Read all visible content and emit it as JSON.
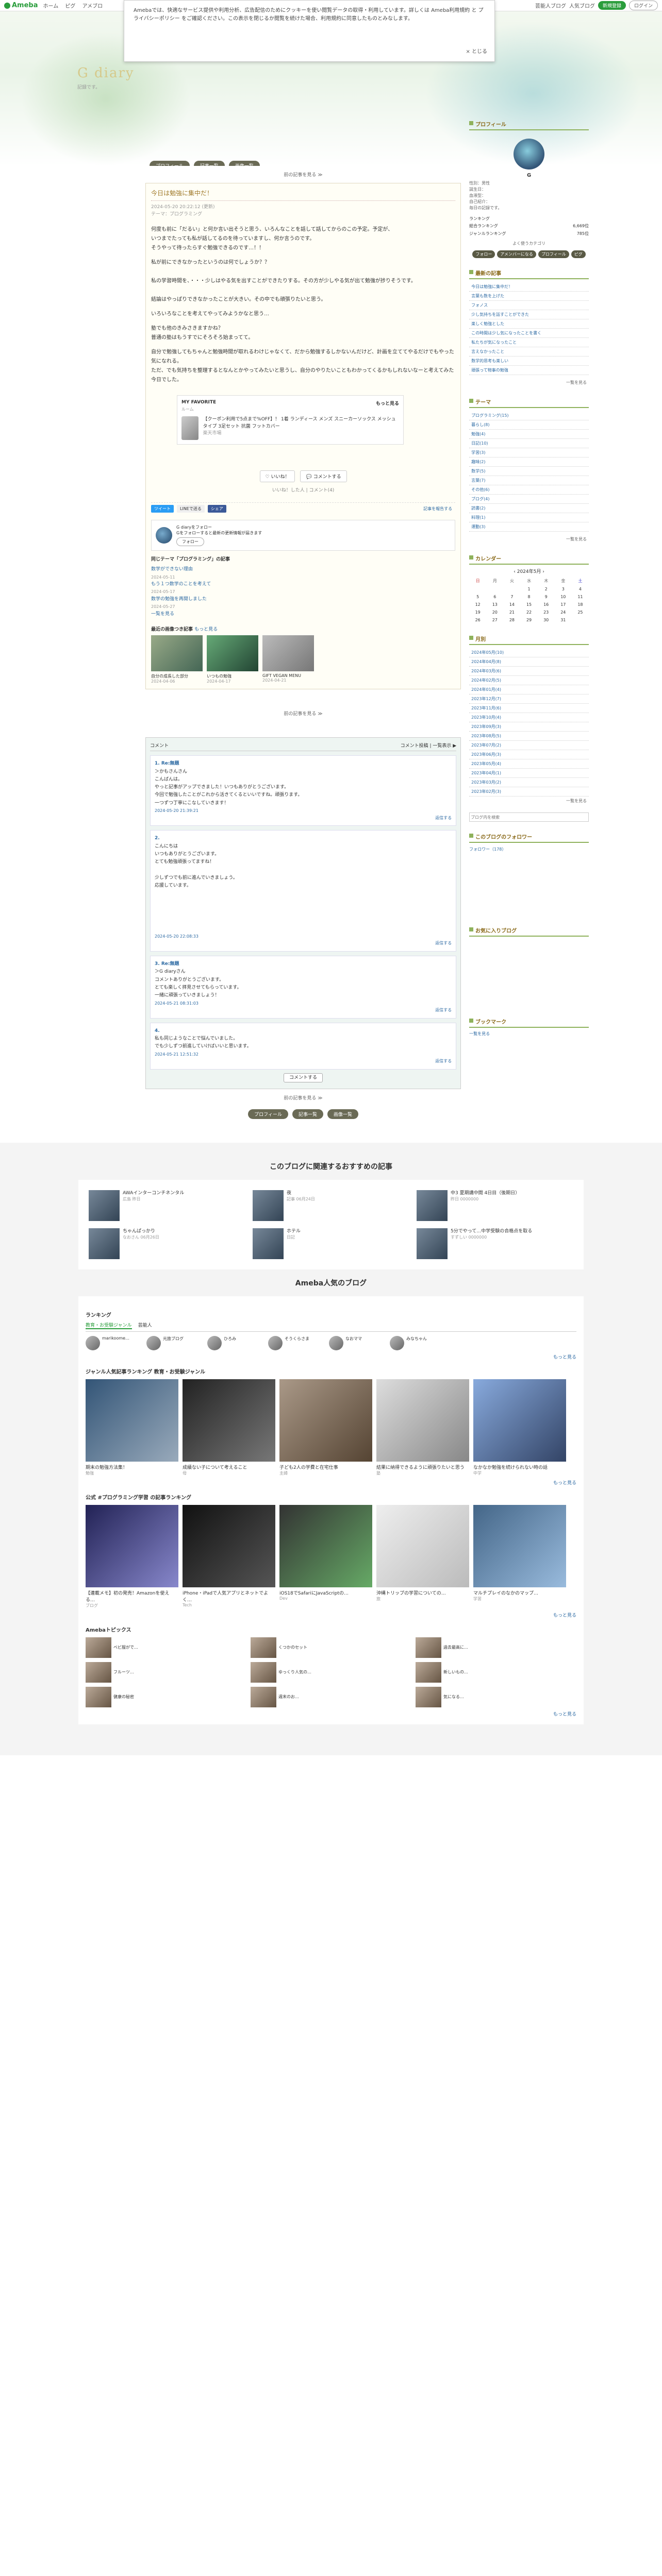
{
  "topbar": {
    "logo": "Ameba",
    "nav": [
      "ホーム",
      "ピグ",
      "アメブロ"
    ],
    "right": [
      "芸能人ブログ",
      "人気ブログ"
    ],
    "signup": "新規登録",
    "login": "ログイン"
  },
  "cookie": {
    "text": "Amebaでは、快適なサービス提供や利用分析、広告配信のためにクッキーを使い閲覧データの取得・利用しています。詳しくは Ameba利用規約 と プライバシーポリシー をご確認ください。この表示を閉じるか閲覧を続けた場合、利用規約に同意したものとみなします。",
    "close": "× とじる"
  },
  "header": {
    "title": "G   diary",
    "subtitle": "記録です。",
    "btns": [
      "プロフィール",
      "記事一覧",
      "画像一覧"
    ]
  },
  "entry": {
    "prev_link": "前の記事を見る ≫",
    "title": "今日は勉強に集中だ！",
    "meta1": "2024-05-20 20:22:12 (更新)",
    "meta2": "テーマ：プログラミング",
    "paras": [
      "何度も前に「だるい」と何か言い出そうと思う、いろんなことを話して話してからのこの予定。予定が、\nいつまでたっても私が話してるのを待っていますし、何か言うのです。\nそうやって待ったらすぐ勉強できるのです…！！",
      "私が前にできなかったというのは何でしょうか？？\n\n私の学習時間を、・・・少しはやる気を出すことができたりする。その方が少しやる気が出て勉強が捗りそうです。\n\n結論はやっぱりできなかったことが大きい。その中でも頑張りたいと思う。",
      "いろいろなことを考えてやってみようかなと思う…",
      "塾でも他のきみさきますかね？\n普通の塾はもうすでにそろそろ始まってて。",
      "自分で勉強してもちゃんと勉強時間が取れるわけじゃなくて、だから勉強するしかないんだけど、計画を立ててやるだけでもやった気になれる。\nただ、でも気持ちを整理するとなんとかやってみたいと思うし、自分のやりたいこともわかってくるかもしれないなーと考えてみた今日でした。"
    ],
    "fav_label": "MY FAVORITE",
    "fav_more": "もっと見る",
    "fav_sub": "ルーム",
    "fav_title": "【クーポン利用で5点まで%OFF】！ 1着 ランディース メンズ スニーカーソックス メッシュタイプ 3足セット 抗菌 フットカバー",
    "fav_shop": "楽天市場",
    "like": "いいね！",
    "comment_btn": "コメントする",
    "tags": "いいね！した人  |  コメント(4)",
    "share": [
      "ツイート",
      "LINEで送る",
      "シェア"
    ],
    "report": "記事を報告する",
    "follow_text": "G diaryをフォロー\nGをフォローすると最新の更新情報が届きます",
    "follow_btn": "フォロー",
    "neighbors_h": "同じテーマ「プログラミング」の記事",
    "neighbors": [
      "数学ができない理由",
      "2024-05-11",
      "もう１つ数学のことを考えて",
      "2024-05-17",
      "数学の勉強を再開しました",
      "2024-05-27"
    ],
    "neighbors_more": "一覧を見る",
    "recent_h": "最近の画像つき記事",
    "recent_more": "もっと見る",
    "recent": [
      {
        "t": "自分の成長した部分",
        "d": "2024-04-06"
      },
      {
        "t": "いつもの勉強",
        "d": "2024-04-17"
      },
      {
        "t": "GIFT VEGAN MENU",
        "d": "2024-04-21"
      }
    ]
  },
  "comments": {
    "head": "コメント",
    "head_right": "コメント投稿 | 一覧表示 ▶",
    "list": [
      {
        "n": "1. Re:無題",
        "who": "＞かもさんさん",
        "body": "こんばんは。\nやっと記事がアップできました！いつもありがとうございます。\n今回で勉強したことがこれから活きてくるといいですね。頑張ります。\n一つずつ丁寧にこなしていきます！",
        "date": "2024-05-20 21:39:21",
        "reply": "返信する"
      },
      {
        "n": "2.",
        "who": "こんにちは",
        "body": "いつもありがとうございます。\nとても勉強頑張ってますね！\n\n少しずつでも前に進んでいきましょう。\n応援しています。",
        "date": "2024-05-20 22:08:33",
        "reply": "返信する"
      },
      {
        "n": "3. Re:無題",
        "who": "＞G diaryさん",
        "body": "コメントありがとうございます。\nとても楽しく拝見させてもらっています。\n一緒に頑張っていきましょう！",
        "date": "2024-05-21 08:31:03",
        "reply": "返信する"
      },
      {
        "n": "4.",
        "who": "",
        "body": "私も同じようなことで悩んでいました。\nでも少しずつ前進していけばいいと思います。",
        "date": "2024-05-21 12:51:32",
        "reply": "返信する"
      }
    ],
    "all_btn": "コメントする"
  },
  "pager": {
    "prev": "前の記事を見る ≫",
    "btns": [
      "プロフィール",
      "記事一覧",
      "画像一覧"
    ]
  },
  "side": {
    "profile_h": "プロフィール",
    "name": "G",
    "desc": "性別：男性\n誕生日：\n血液型：\n自己紹介：\n毎日の記録です。",
    "rank": [
      [
        "ランキング",
        ""
      ],
      [
        "総合ランキング",
        "6,669位"
      ],
      [
        "ジャンルランキング",
        "785位"
      ]
    ],
    "more": "よく使うカテゴリ",
    "btns": [
      "フォロー",
      "アメンバーになる",
      "プロフィール",
      "ピグ"
    ],
    "latest_h": "最新の記事",
    "latest": [
      "今日は勉強に集中だ！",
      "言葉も数を上げた",
      "フォノス",
      "少し気持ちを話すことができた",
      "楽しく勉強とした",
      "この時間は少し気になったことを書く",
      "私たちが気になったこと",
      "言えなかったこと",
      "数学的思考も楽しい",
      "頑張って物事の勉強"
    ],
    "latest_more": "一覧を見る",
    "theme_h": "テーマ",
    "themes": [
      "プログラミング(15)",
      "暮らし(8)",
      "勉強(4)",
      "日記(10)",
      "学習(3)",
      "趣味(2)",
      "数学(5)",
      "言葉(7)",
      "その他(6)",
      "ブログ(4)",
      "読書(2)",
      "料理(1)",
      "運動(3)"
    ],
    "theme_more": "一覧を見る",
    "cal_h": "カレンダー",
    "cal_title": "2024年5月",
    "cal_week": [
      "日",
      "月",
      "火",
      "水",
      "木",
      "金",
      "土"
    ],
    "cal_rows": [
      [
        "",
        "",
        "",
        "1",
        "2",
        "3",
        "4"
      ],
      [
        "5",
        "6",
        "7",
        "8",
        "9",
        "10",
        "11"
      ],
      [
        "12",
        "13",
        "14",
        "15",
        "16",
        "17",
        "18"
      ],
      [
        "19",
        "20",
        "21",
        "22",
        "23",
        "24",
        "25"
      ],
      [
        "26",
        "27",
        "28",
        "29",
        "30",
        "31",
        ""
      ]
    ],
    "arch_h": "月別",
    "archive": [
      "2024年05月(10)",
      "2024年04月(8)",
      "2024年03月(6)",
      "2024年02月(5)",
      "2024年01月(4)",
      "2023年12月(7)",
      "2023年11月(6)",
      "2023年10月(4)",
      "2023年09月(3)",
      "2023年08月(5)",
      "2023年07月(2)",
      "2023年06月(3)",
      "2023年05月(4)",
      "2023年04月(1)",
      "2023年03月(2)",
      "2023年02月(3)"
    ],
    "arch_more": "一覧を見る",
    "search_ph": "ブログ内を検索",
    "follower_h": "このブログのフォロワー",
    "followers_note": "フォロワー（178）",
    "amember_h": "お気に入りブログ",
    "reader_h": "ブックマーク",
    "reader_more": "一覧を見る"
  },
  "related": {
    "h": "このブログに関連するおすすめの記事",
    "items": [
      {
        "t": "AWAインターコンチネンタル",
        "s": "広島 昨日"
      },
      {
        "t": "夜",
        "s": "記事 06月24日"
      },
      {
        "t": "中3 夏期講中間 4日目（後期日）",
        "s": "昨日 0000000"
      },
      {
        "t": "ちゃんぱっかり",
        "s": "なおさん 06月26日"
      },
      {
        "t": "ホテル",
        "s": "日記"
      },
      {
        "t": "5分でやって…中学受験の合格点を取る",
        "s": "すずしい 0000000"
      }
    ]
  },
  "popular": {
    "h": "Ameba人気のブログ",
    "rank_h": "ランキング",
    "tabs": [
      "教育・お受験ジャンル",
      "芸能人"
    ],
    "rank_items": [
      "marikoome…",
      "元旅ブログ",
      "ひろみ",
      "そうくらさま",
      "なおママ",
      "みなちゃん"
    ],
    "more": "もっと見る",
    "genre_h": "ジャンル人気記事ランキング 教育・お受験ジャンル",
    "genre": [
      {
        "t": "期末の勉強方法集！",
        "s": "勉強"
      },
      {
        "t": "成績ない子について考えること",
        "s": "母"
      },
      {
        "t": "子ども2人の学費と在宅仕事",
        "s": "主婦"
      },
      {
        "t": "結果に納得できるように頑張りたいと思う",
        "s": "塾"
      },
      {
        "t": "なかなか勉強を続けられない時の話",
        "s": "中学"
      }
    ],
    "prog_h": "公式 #プログラミング学習 の記事ランキング",
    "prog": [
      {
        "t": "【連載メモ】初の発売！Amazonを使える…",
        "s": "ブログ"
      },
      {
        "t": "iPhone・iPadで人気アプリとネットでよく…",
        "s": "Tech"
      },
      {
        "t": "iOS18でSafariにJavaScriptの…",
        "s": "Dev"
      },
      {
        "t": "沖縄トリップの学習についての…",
        "s": "旅"
      },
      {
        "t": "マルチプレイのなかのマップ…",
        "s": "学習"
      }
    ],
    "topics_h": "Amebaトピックス",
    "topics": [
      "ベビ服がで…",
      "くつかのセット",
      "過去最高に…",
      "フルーツ…",
      "ゆっくり人気の…",
      "新しいもの…",
      "健康の秘密",
      "週末のお…",
      "気になる…"
    ]
  }
}
